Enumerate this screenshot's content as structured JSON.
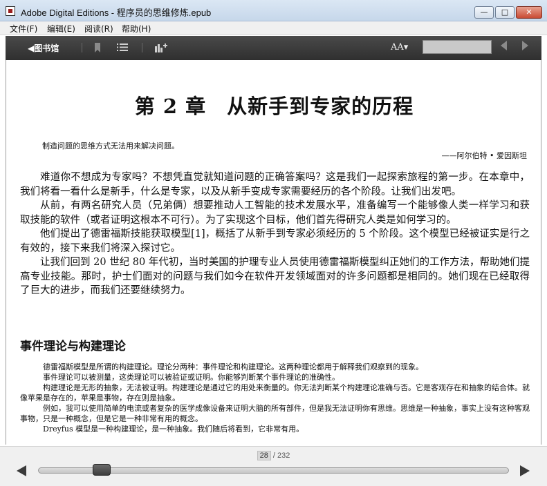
{
  "window": {
    "title": "Adobe Digital Editions - 程序员的思维修炼.epub",
    "minimize": "—",
    "maximize": "□",
    "close": "✕"
  },
  "menu": [
    "文件(F)",
    "编辑(E)",
    "阅读(R)",
    "帮助(H)"
  ],
  "toolbar": {
    "library_label": "◀图书馆",
    "font_size_label": "AA▾",
    "icons": [
      "bookmark-icon",
      "list-icon",
      "chart-icon",
      "prev-page-icon",
      "next-page-icon"
    ]
  },
  "content": {
    "chapter_title": "第 2 章　从新手到专家的历程",
    "epigraph": "制造问题的思维方式无法用来解决问题。",
    "attribution": "——阿尔伯特 • 爱因斯坦",
    "paragraphs": [
      "难道你不想成为专家吗？不想凭直觉就知道问题的正确答案吗？这是我们一起探索旅程的第一步。在本章中，我们将看一看什么是新手，什么是专家，以及从新手变成专家需要经历的各个阶段。让我们出发吧。",
      "从前，有两名研究人员（兄弟俩）想要推动人工智能的技术发展水平，准备编写一个能够像人类一样学习和获取技能的软件（或者证明这根本不可行）。为了实现这个目标，他们首先得研究人类是如何学习的。",
      "他们提出了德雷福斯技能获取模型[1]，概括了从新手到专家必须经历的 5 个阶段。这个模型已经被证实是行之有效的，接下来我们将深入探讨它。",
      "让我们回到 20 世纪 80 年代初，当时美国的护理专业人员使用德雷福斯模型纠正她们的工作方法，帮助她们提高专业技能。那时，护士们面对的问题与我们如今在软件开发领域面对的许多问题都是相同的。她们现在已经取得了巨大的进步，而我们还要继续努力。"
    ],
    "section_heading": "事件理论与构建理论",
    "small_paragraphs": [
      "德雷福斯模型是所谓的构建理论。理论分两种：事件理论和构建理论。这两种理论都用于解释我们观察到的现象。",
      "事件理论可以被测量，这类理论可以被验证或证明。你能够判断某个事件理论的准确性。",
      "构建理论是无形的抽象，无法被证明。构建理论是通过它的用处来衡量的。你无法判断某个构建理论准确与否。它是客观存在和抽象的结合体。就像苹果是存在的，苹果是事物，存在则是抽象。",
      "例如，我可以使用简单的电流或者复杂的医学成像设备来证明大脑的所有部件，但是我无法证明你有思维。思维是一种抽象，事实上没有这种客观事物，只是一种概念，但是它是一种非常有用的概念。",
      "Dreyfus 模型是一种构建理论，是一种抽象。我们随后将看到，它非常有用。"
    ]
  },
  "navigation": {
    "current_page": "28",
    "total_pages": "/ 232",
    "progress": 0.12
  }
}
